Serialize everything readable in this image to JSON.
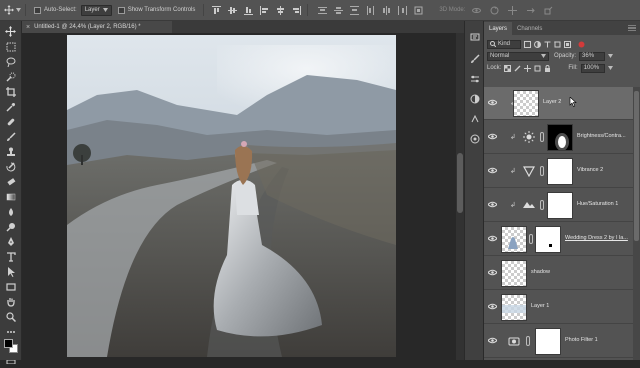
{
  "options_bar": {
    "auto_select_label": "Auto-Select:",
    "auto_select_target": "Layer",
    "transform_controls_label": "Show Transform Controls",
    "mode_3d_label": "3D Mode:"
  },
  "document_tab": {
    "title": "Untitled-1 @ 24,4% (Layer 2, RGB/16) *"
  },
  "panel_tabs": [
    "Layers",
    "Channels"
  ],
  "layers_panel": {
    "filter_kind": "Kind",
    "blend_mode": "Normal",
    "opacity_label": "Opacity:",
    "opacity_value": "36%",
    "lock_label": "Lock:",
    "fill_label": "Fill:",
    "fill_value": "100%"
  },
  "layers": [
    {
      "name": "Layer 2",
      "selected": true
    },
    {
      "name": "Brightness/Contra...",
      "selected": false
    },
    {
      "name": "Vibrance 2",
      "selected": false
    },
    {
      "name": "Hue/Saturation 1",
      "selected": false
    },
    {
      "name": "Wedding Dress 2 by I la...",
      "selected": false
    },
    {
      "name": "shadow",
      "selected": false
    },
    {
      "name": "Layer 1",
      "selected": false
    },
    {
      "name": "Photo Filter 1",
      "selected": false
    }
  ],
  "colors": {
    "panel_bg": "#535353",
    "dark_bg": "#282828",
    "toolbar_bg": "#3c3c3c",
    "selected_layer": "#6b6b6b"
  }
}
